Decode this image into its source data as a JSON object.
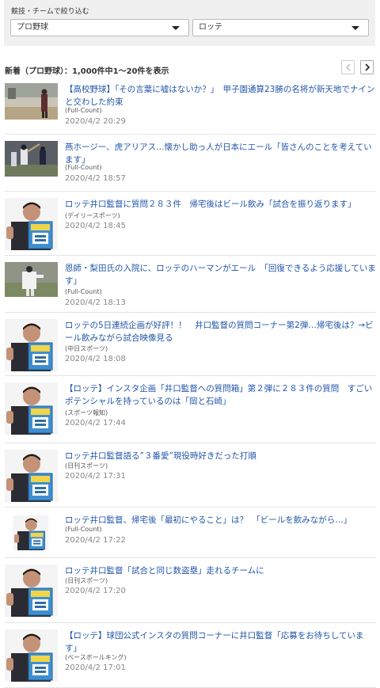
{
  "filter": {
    "title": "競技・チームで絞り込む",
    "sport_value": "プロ野球",
    "team_value": "ロッテ"
  },
  "results": {
    "summary": "新着（プロ野球）：1,000件中1～20件を表示"
  },
  "colors": {
    "headline_link": "#2255aa",
    "panel_bg": "#f0f0f0"
  },
  "news": [
    {
      "headline": "【高校野球】「その言葉に嘘はないか？」　甲子園通算23勝の名将が新天地でナインと交わした約束",
      "source": "(Full-Count)",
      "date": "2020/4/2 20:29",
      "thumb": "coach-field-photo"
    },
    {
      "headline": "燕ホージー、虎アリアス…懐かし助っ人が日本にエール「皆さんのことを考えています」",
      "source": "(Full-Count)",
      "date": "2020/4/2 18:57",
      "thumb": "batter-photo"
    },
    {
      "headline": "ロッテ井口監督に質問２８３件　帰宅後はビール飲み「試合を振り返ります」",
      "source": "(デイリースポーツ)",
      "date": "2020/4/2 18:45",
      "thumb": "manager-sign-photo"
    },
    {
      "headline": "恩師・梨田氏の入院に、ロッテのハーマンがエール　「回復できるよう応援しています」",
      "source": "(Full-Count)",
      "date": "2020/4/2 18:13",
      "thumb": "pitcher-photo"
    },
    {
      "headline": "ロッテの5日連続企画が好評！！　井口監督の質問コーナー第2弾…帰宅後は？→ビール飲みながら試合映像見る",
      "source": "(中日スポーツ)",
      "date": "2020/4/2 18:08",
      "thumb": "manager-sign-photo"
    },
    {
      "headline": "【ロッテ】インスタ企画「井口監督への質問箱」第２弾に２８３件の質問　すごいポテンシャルを持っているのは「岡と石崎」",
      "source": "(スポーツ報知)",
      "date": "2020/4/2 17:44",
      "thumb": "manager-sign-photo"
    },
    {
      "headline": "ロッテ井口監督語る”３番愛”現役時好きだった打順",
      "source": "(日刊スポーツ)",
      "date": "2020/4/2 17:31",
      "thumb": "manager-sign-photo"
    },
    {
      "headline": "ロッテ井口監督、帰宅後「最初にやること」は？　「ビールを飲みながら…」",
      "source": "(Full-Count)",
      "date": "2020/4/2 17:22",
      "thumb": "manager-sign-photo"
    },
    {
      "headline": "ロッテ井口監督「試合と同じ数盗塁」走れるチームに",
      "source": "(日刊スポーツ)",
      "date": "2020/4/2 17:20",
      "thumb": "manager-sign-photo"
    },
    {
      "headline": "【ロッテ】球団公式インスタの質問コーナーに井口監督「応募をお待ちしています」",
      "source": "(ベースボールキング)",
      "date": "2020/4/2 17:01",
      "thumb": "manager-sign-photo"
    }
  ]
}
